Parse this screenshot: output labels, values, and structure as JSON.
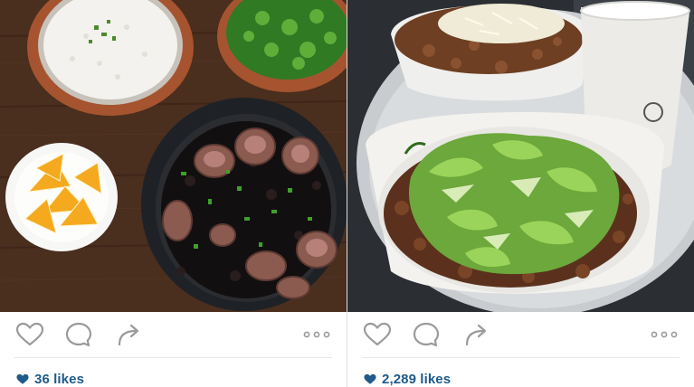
{
  "posts": [
    {
      "id": "left",
      "photo_subject": "feijoada-meal",
      "likes": "36 likes",
      "icons": [
        "heart-icon",
        "comment-icon",
        "share-icon",
        "more-icon"
      ]
    },
    {
      "id": "right",
      "photo_subject": "burrito-bowl",
      "likes": "2,289 likes",
      "icons": [
        "heart-icon",
        "comment-icon",
        "share-icon",
        "more-icon"
      ]
    }
  ],
  "colors": {
    "likes_text": "#1f5a8a",
    "icon_stroke": "#9a9a9a",
    "divider": "#dcdcdc"
  }
}
